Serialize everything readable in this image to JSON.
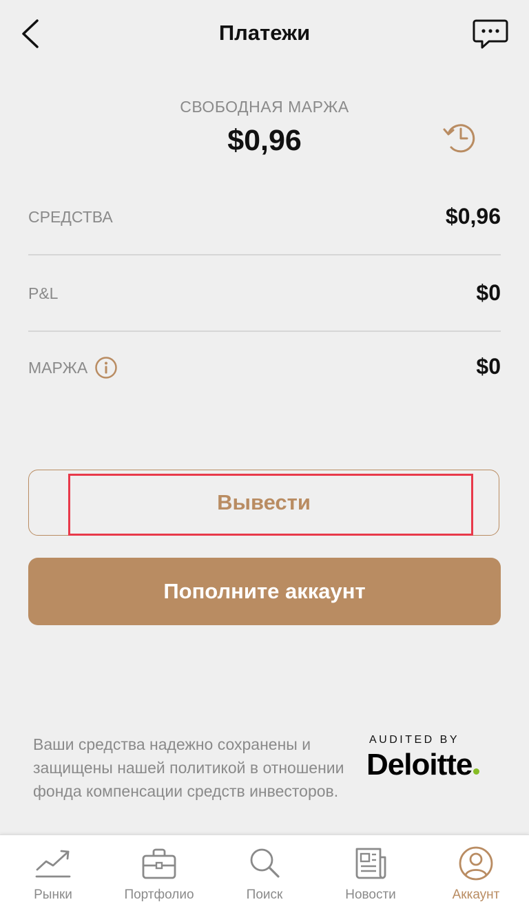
{
  "header": {
    "title": "Платежи",
    "back_icon": "chevron-left-icon",
    "chat_icon": "chat-bubble-icon"
  },
  "summary": {
    "free_margin_label": "СВОБОДНАЯ МАРЖА",
    "free_margin_value": "$0,96",
    "history_icon": "history-icon"
  },
  "rows": [
    {
      "label": "СРЕДСТВА",
      "value": "$0,96"
    },
    {
      "label": "P&L",
      "value": "$0"
    },
    {
      "label": "МАРЖА",
      "value": "$0",
      "info_icon": "info-icon"
    }
  ],
  "actions": {
    "withdraw_label": "Вывести",
    "deposit_label": "Пополните аккаунт"
  },
  "footer": {
    "disclaimer": "Ваши средства надежно сохранены и защищены нашей политикой в отношении фонда компенсации средств инвесторов.",
    "audited_by": "AUDITED BY",
    "auditor": "Deloitte"
  },
  "tabbar": {
    "items": [
      {
        "label": "Рынки",
        "icon": "chart-trend-icon",
        "active": false
      },
      {
        "label": "Портфолио",
        "icon": "briefcase-icon",
        "active": false
      },
      {
        "label": "Поиск",
        "icon": "search-icon",
        "active": false
      },
      {
        "label": "Новости",
        "icon": "newspaper-icon",
        "active": false
      },
      {
        "label": "Аккаунт",
        "icon": "user-icon",
        "active": true
      }
    ]
  },
  "colors": {
    "accent": "#b98c62",
    "background": "#efefef",
    "highlight": "#e8394a",
    "deloitte_dot": "#86bc25",
    "muted_text": "#8a8a8a"
  }
}
